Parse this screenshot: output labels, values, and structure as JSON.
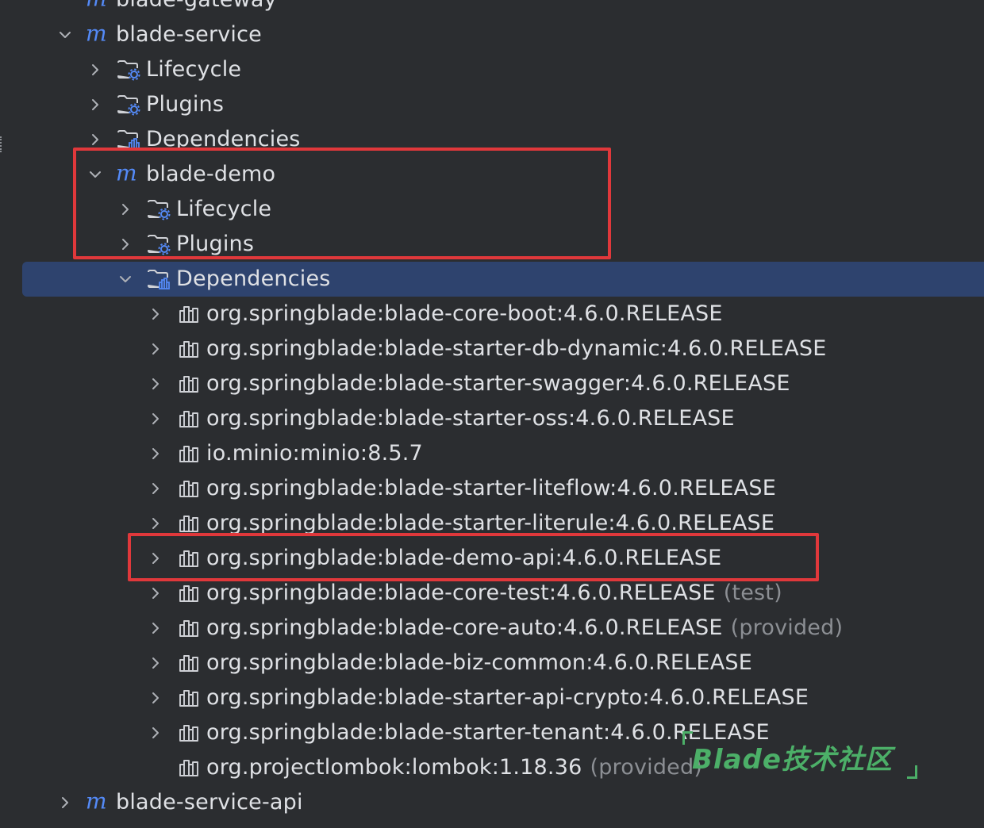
{
  "tree": {
    "top_partial": {
      "label": "blade-gateway",
      "icon": "maven-module-icon"
    },
    "blade_service": {
      "label": "blade-service",
      "icon": "maven-module-icon",
      "children": [
        {
          "label": "Lifecycle",
          "icon": "folder-lifecycle-icon"
        },
        {
          "label": "Plugins",
          "icon": "folder-plugins-icon"
        },
        {
          "label": "Dependencies",
          "icon": "folder-dependencies-icon"
        }
      ]
    },
    "blade_demo": {
      "label": "blade-demo",
      "icon": "maven-module-icon",
      "children": [
        {
          "label": "Lifecycle",
          "icon": "folder-lifecycle-icon"
        },
        {
          "label": "Plugins",
          "icon": "folder-plugins-icon"
        },
        {
          "label": "Dependencies",
          "icon": "folder-dependencies-icon"
        }
      ]
    },
    "dependencies": [
      {
        "label": "org.springblade:blade-core-boot:4.6.0.RELEASE",
        "scope": ""
      },
      {
        "label": "org.springblade:blade-starter-db-dynamic:4.6.0.RELEASE",
        "scope": ""
      },
      {
        "label": "org.springblade:blade-starter-swagger:4.6.0.RELEASE",
        "scope": ""
      },
      {
        "label": "org.springblade:blade-starter-oss:4.6.0.RELEASE",
        "scope": ""
      },
      {
        "label": "io.minio:minio:8.5.7",
        "scope": ""
      },
      {
        "label": "org.springblade:blade-starter-liteflow:4.6.0.RELEASE",
        "scope": ""
      },
      {
        "label": "org.springblade:blade-starter-literule:4.6.0.RELEASE",
        "scope": ""
      },
      {
        "label": "org.springblade:blade-demo-api:4.6.0.RELEASE",
        "scope": ""
      },
      {
        "label": "org.springblade:blade-core-test:4.6.0.RELEASE",
        "scope": "(test)"
      },
      {
        "label": "org.springblade:blade-core-auto:4.6.0.RELEASE",
        "scope": "(provided)"
      },
      {
        "label": "org.springblade:blade-biz-common:4.6.0.RELEASE",
        "scope": ""
      },
      {
        "label": "org.springblade:blade-starter-api-crypto:4.6.0.RELEASE",
        "scope": ""
      },
      {
        "label": "org.springblade:blade-starter-tenant:4.6.0.RELEASE",
        "scope": ""
      },
      {
        "label": "org.projectlombok:lombok:1.18.36",
        "scope": "(provided)"
      }
    ],
    "bottom": {
      "label": "blade-service-api",
      "icon": "maven-module-icon"
    }
  },
  "watermark": {
    "text": "Blade技术社区"
  },
  "colors": {
    "background": "#2b2d30",
    "selection": "#2e436e",
    "text": "#dfe1e5",
    "muted": "#8c8f94",
    "maven_blue": "#548af7",
    "highlight_red": "#e0383b",
    "watermark_green": "#4caf68"
  }
}
